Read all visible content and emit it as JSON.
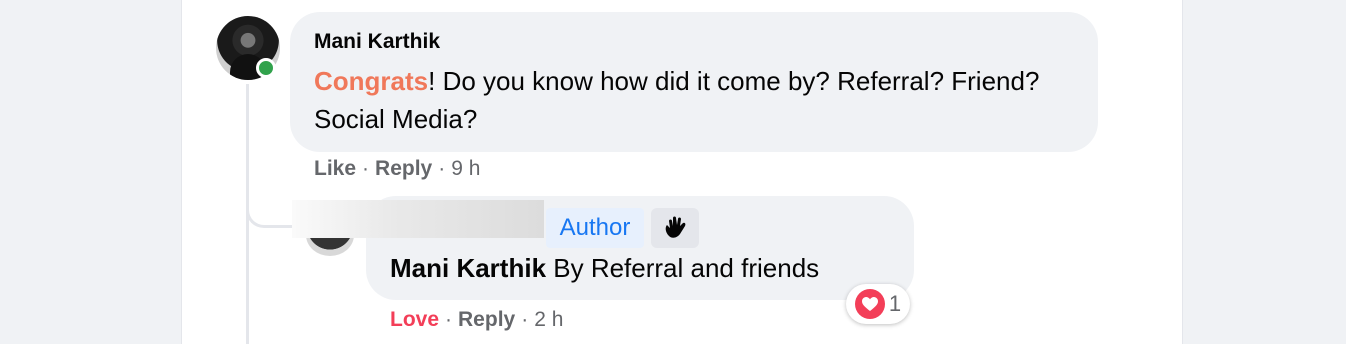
{
  "comment": {
    "author": "Mani Karthik",
    "text_highlight": "Congrats",
    "text_rest": "! Do you know how did it come by? Referral? Friend? Social Media?",
    "actions": {
      "like": "Like",
      "reply": "Reply",
      "time": "9 h",
      "sep": "·"
    }
  },
  "reply": {
    "author_badge": "Author",
    "badge_icon": "wave-hand-icon",
    "mention": "Mani Karthik",
    "text": " By Referral and friends",
    "actions": {
      "react": "Love",
      "reply": "Reply",
      "time": "2 h",
      "sep": "·"
    },
    "reaction": {
      "icon": "heart-icon",
      "count": "1"
    }
  },
  "colors": {
    "highlight": "#f0785a",
    "love": "#f33e58",
    "online": "#31a24c",
    "author_badge": "#1877f2"
  }
}
